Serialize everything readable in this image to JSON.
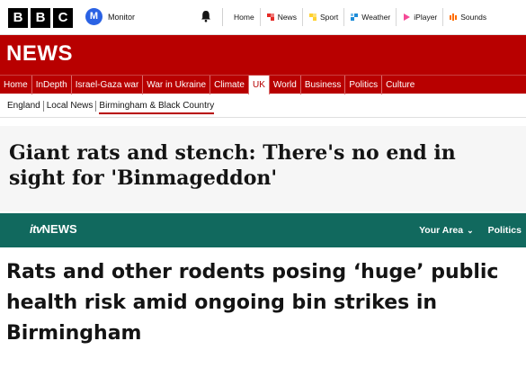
{
  "bbc": {
    "logo_letters": [
      "B",
      "B",
      "C"
    ],
    "monitor_badge": "M",
    "monitor_label": "Monitor",
    "topnav": [
      {
        "label": "Home",
        "icon": "none"
      },
      {
        "label": "News",
        "icon": "news-icon",
        "color": "#e52b27"
      },
      {
        "label": "Sport",
        "icon": "sport-icon",
        "color": "#ffd230"
      },
      {
        "label": "Weather",
        "icon": "weather-icon",
        "color": "#1e8cd8"
      },
      {
        "label": "iPlayer",
        "icon": "iplayer-icon",
        "color": "#f54997"
      },
      {
        "label": "Sounds",
        "icon": "sounds-icon",
        "color": "#ff6d00"
      }
    ]
  },
  "news": {
    "title": "NEWS",
    "nav": [
      "Home",
      "InDepth",
      "Israel-Gaza war",
      "War in Ukraine",
      "Climate",
      "UK",
      "World",
      "Business",
      "Politics",
      "Culture"
    ],
    "active_nav": "UK",
    "subnav": [
      "England",
      "Local News",
      "Birmingham & Black Country"
    ],
    "current_subnav": "Birmingham & Black Country",
    "headline": "Giant rats and stench: There's no end in sight for 'Binmageddon'"
  },
  "itv": {
    "logo_itv": "itv",
    "logo_news": "NEWS",
    "your_area": "Your Area",
    "politics": "Politics",
    "article_title": "Rats and other rodents posing ‘huge’ public health risk amid ongoing bin strikes in Birmingham"
  },
  "colors": {
    "bbc_red": "#b80000",
    "itv_teal": "#11695e",
    "monitor_blue": "#2a62e4"
  }
}
